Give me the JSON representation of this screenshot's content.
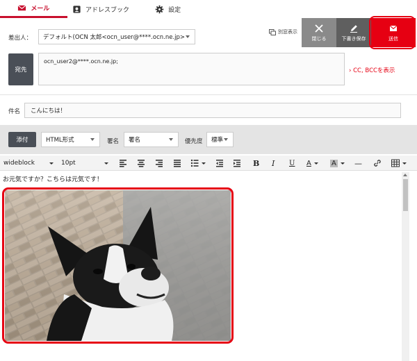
{
  "tabs": [
    {
      "label": "メール",
      "icon": "mail-icon",
      "active": true
    },
    {
      "label": "アドレスブック",
      "icon": "contact-icon",
      "active": false
    },
    {
      "label": "設定",
      "icon": "gear-icon",
      "active": false
    }
  ],
  "sender": {
    "label": "差出人：",
    "value": "デフォルト(OCN 太郎<ocn_user@****.ocn.ne.jp>"
  },
  "separate_window_label": "別窓表示",
  "actions": {
    "close_label": "閉じる",
    "draft_label": "下書き保存",
    "send_label": "送信"
  },
  "recipient": {
    "to_label": "宛先",
    "to_value": "ocn_user2@****.ocn.ne.jp;",
    "cc_bcc_link": "CC, BCCを表示"
  },
  "subject": {
    "label": "件名",
    "value": "こんにちは！"
  },
  "options": {
    "attach_label": "添付",
    "format_value": "HTML形式",
    "signature_label": "署名",
    "signature_value": "署名",
    "priority_label": "優先度",
    "priority_value": "標準"
  },
  "editor_toolbar": {
    "font_family": "wideblock",
    "font_size": "10pt",
    "bold": "B",
    "italic": "I",
    "underline": "U",
    "font_color": "A",
    "highlight": "A",
    "hr": "—"
  },
  "body": {
    "text": "お元気ですか？こちらは元気です！"
  },
  "colors": {
    "accent": "#e60012",
    "dark_button": "#4a4f57",
    "close_bg": "#8a8a8a",
    "draft_bg": "#5f5f5f"
  }
}
